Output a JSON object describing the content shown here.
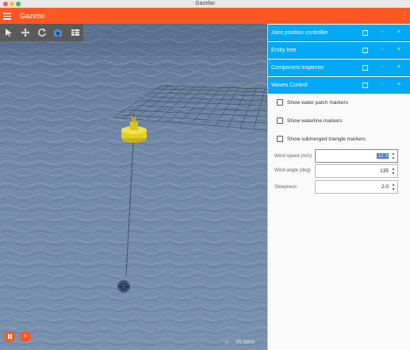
{
  "window": {
    "title": "Gazebo"
  },
  "appbar": {
    "title": "Gazebo"
  },
  "toolbar": {
    "icons": [
      "select-icon",
      "translate-icon",
      "rotate-icon",
      "screenshot-icon",
      "grid-config-icon"
    ]
  },
  "bottom": {
    "step_glyph": "»",
    "rtf_arrow": "»",
    "rtf": "35.88%"
  },
  "panels": [
    {
      "title": "Joint position controller"
    },
    {
      "title": "Entity tree"
    },
    {
      "title": "Component inspector"
    },
    {
      "title": "Waves Control"
    }
  ],
  "panel_controls": {
    "minimize": "-",
    "close": "×"
  },
  "waves": {
    "checkboxes": [
      {
        "label": "Show water patch markers",
        "checked": false
      },
      {
        "label": "Show waterline markers",
        "checked": false
      },
      {
        "label": "Show submerged triangle markers",
        "checked": false
      }
    ],
    "fields": [
      {
        "label": "Wind speed (m/s)",
        "value": "12.3"
      },
      {
        "label": "Wind angle (deg)",
        "value": "135"
      },
      {
        "label": "Steepness",
        "value": "2.0"
      }
    ]
  },
  "colors": {
    "accent": "#ff5722",
    "panel_header": "#03a9f4",
    "toolbar": "#5a5a5a",
    "water": "#6f87a6"
  }
}
